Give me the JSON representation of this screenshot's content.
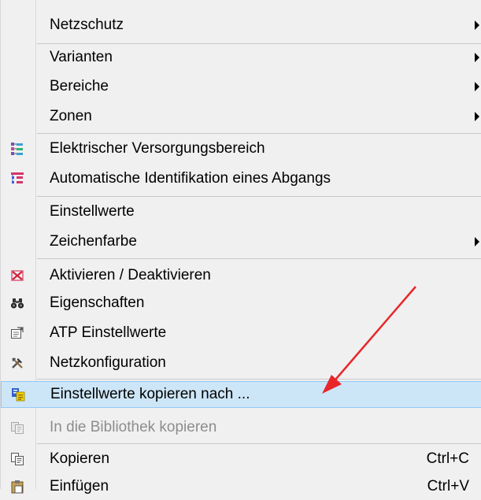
{
  "menu": {
    "items": [
      {
        "label": "Netzschutz",
        "submenu": true
      },
      {
        "label": "Varianten",
        "submenu": true
      },
      {
        "label": "Bereiche",
        "submenu": true
      },
      {
        "label": "Zonen",
        "submenu": true
      },
      {
        "label": "Elektrischer Versorgungsbereich",
        "icon": "supply-area-icon"
      },
      {
        "label": "Automatische Identifikation eines Abgangs",
        "icon": "feeder-identification-icon"
      },
      {
        "label": "Einstellwerte"
      },
      {
        "label": "Zeichenfarbe",
        "submenu": true
      },
      {
        "label": "Aktivieren / Deaktivieren",
        "icon": "activate-deactivate-icon"
      },
      {
        "label": "Eigenschaften",
        "icon": "binoculars-icon"
      },
      {
        "label": "ATP Einstellwerte",
        "icon": "atp-settings-icon"
      },
      {
        "label": "Netzkonfiguration",
        "icon": "tools-icon"
      },
      {
        "label": "Einstellwerte kopieren nach ...",
        "icon": "copy-settings-icon",
        "highlighted": true
      },
      {
        "label": "In die Bibliothek kopieren",
        "icon": "library-copy-icon",
        "disabled": true
      },
      {
        "label": "Kopieren",
        "icon": "copy-icon",
        "shortcut": "Ctrl+C"
      },
      {
        "label": "Einfügen",
        "icon": "paste-icon",
        "shortcut": "Ctrl+V"
      }
    ]
  },
  "colors": {
    "menu_background": "#f0f0f0",
    "highlight_background": "#cde6f7",
    "highlight_border": "#90c8f6",
    "annotation_arrow": "#e8262a"
  }
}
